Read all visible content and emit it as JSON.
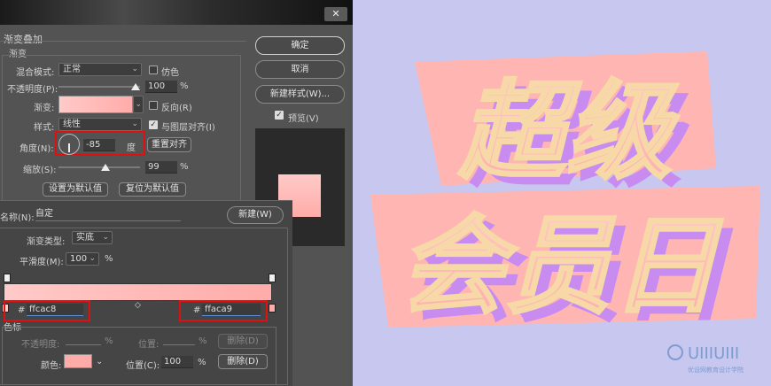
{
  "dialog_top": {
    "close_label": "✕",
    "section_title": "渐变叠加",
    "group_title": "渐变",
    "blend_mode_label": "混合模式:",
    "blend_mode_value": "正常",
    "dither_label": "仿色",
    "opacity_label": "不透明度(P):",
    "opacity_value": "100",
    "opacity_unit": "%",
    "gradient_label": "渐变:",
    "reverse_label": "反向(R)",
    "style_label": "样式:",
    "style_value": "线性",
    "align_label": "与图层对齐(I)",
    "angle_label": "角度(N):",
    "angle_value": "-85",
    "angle_unit": "度",
    "reset_align_label": "重置对齐",
    "scale_label": "缩放(S):",
    "scale_value": "99",
    "scale_unit": "%",
    "set_default_label": "设置为默认值",
    "reset_default_label": "复位为默认值",
    "ok_label": "确定",
    "cancel_label": "取消",
    "new_style_label": "新建样式(W)...",
    "preview_label": "预览(V)"
  },
  "gradient_editor": {
    "name_label": "名称(N):",
    "name_value": "自定",
    "new_label": "新建(W)",
    "type_label": "渐变类型:",
    "type_value": "实底",
    "smooth_label": "平滑度(M):",
    "smooth_value": "100",
    "smooth_unit": "%",
    "hash": "#",
    "left_hex": "ffcac8",
    "right_hex": "ffaca9",
    "stops_title": "色标",
    "stop_opacity_label": "不透明度:",
    "stop_opacity_unit": "%",
    "stop_pos_label": "位置:",
    "stop_pos_unit": "%",
    "delete_label": "删除(D)",
    "color_label": "颜色:",
    "color_pos_label": "位置(C):",
    "color_pos_value": "100",
    "color_pos_unit": "%",
    "delete2_label": "删除(D)"
  },
  "artwork": {
    "line1": "超级",
    "line2": "会员日",
    "logo_text": "UIIIUIII",
    "logo_sub": "优设网教育设计学院"
  },
  "colors": {
    "bg": "#c7c7ef",
    "pink_light": "#ffcac8",
    "pink_dark": "#ffaca9",
    "shadow_purple": "#c88cf0",
    "outline_gold": "#f7d9a8"
  }
}
